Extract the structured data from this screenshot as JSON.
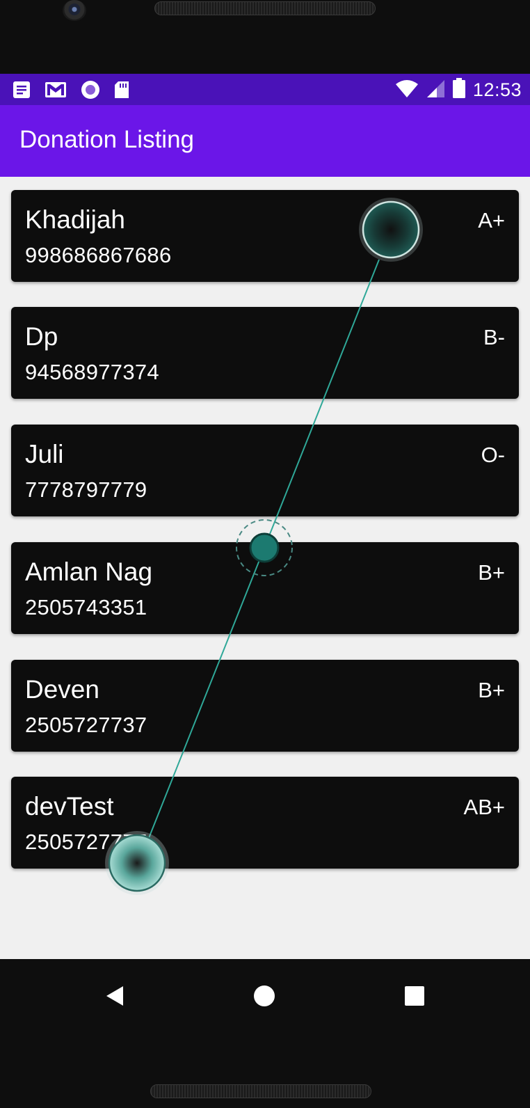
{
  "status_bar": {
    "time": "12:53",
    "left_icons": [
      "notes-icon",
      "gmail-icon",
      "record-icon",
      "sd-card-icon"
    ],
    "right_icons": [
      "wifi-icon",
      "signal-icon",
      "battery-icon"
    ],
    "color": "#4a12b8"
  },
  "app_bar": {
    "title": "Donation Listing",
    "color": "#6b16e8"
  },
  "donations": [
    {
      "name": "Khadijah",
      "phone": "998686867686",
      "blood_group": "A+"
    },
    {
      "name": "Dp",
      "phone": "94568977374",
      "blood_group": "B-"
    },
    {
      "name": "Juli",
      "phone": "7778797779",
      "blood_group": "O-"
    },
    {
      "name": "Amlan Nag",
      "phone": "2505743351",
      "blood_group": "B+"
    },
    {
      "name": "Deven",
      "phone": "2505727737",
      "blood_group": "B+"
    },
    {
      "name": "devTest",
      "phone": "2505727777",
      "blood_group": "AB+"
    }
  ],
  "nav_bar": {
    "icons": [
      "back-icon",
      "home-icon",
      "recents-icon"
    ]
  },
  "colors": {
    "card_background": "#0d0d0d",
    "list_background": "#f0f0f0",
    "gesture_accent": "#1f8a80"
  }
}
